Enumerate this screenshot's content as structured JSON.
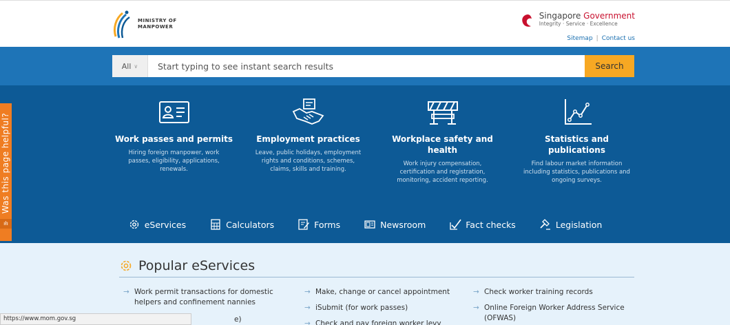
{
  "header": {
    "logo_line1": "MINISTRY OF",
    "logo_line2": "MANPOWER",
    "gov_name_a": "Singapore ",
    "gov_name_b": "Government",
    "gov_tagline": "Integrity · Service · Excellence",
    "links": [
      "Sitemap",
      "Contact us"
    ]
  },
  "search": {
    "scope": "All",
    "placeholder": "Start typing to see instant search results",
    "button": "Search"
  },
  "categories": [
    {
      "icon": "id-card-icon",
      "title": "Work passes and permits",
      "desc": "Hiring foreign manpower, work passes, eligibility, applications, renewals."
    },
    {
      "icon": "handshake-icon",
      "title": "Employment practices",
      "desc": "Leave, public holidays, employment rights and conditions, schemes, claims, skills and training."
    },
    {
      "icon": "barrier-icon",
      "title": "Workplace safety and health",
      "desc": "Work injury compensation, certification and registration, monitoring, accident reporting."
    },
    {
      "icon": "line-chart-icon",
      "title": "Statistics and publications",
      "desc": "Find labour market information including statistics, publications and ongoing surveys."
    }
  ],
  "quicklinks": [
    {
      "icon": "gear-icon",
      "label": "eServices"
    },
    {
      "icon": "calculator-icon",
      "label": "Calculators"
    },
    {
      "icon": "form-icon",
      "label": "Forms"
    },
    {
      "icon": "newspaper-icon",
      "label": "Newsroom"
    },
    {
      "icon": "checkmark-icon",
      "label": "Fact checks"
    },
    {
      "icon": "gavel-icon",
      "label": "Legislation"
    }
  ],
  "feedback": {
    "label": "Was this page helpful?",
    "foot": "ıłı"
  },
  "popular": {
    "title": "Popular eServices",
    "col1": [
      "Work permit transactions for domestic helpers and confinement nannies",
      "e)"
    ],
    "col2": [
      "Make, change or cancel appointment",
      "iSubmit (for work passes)",
      "Check and pay foreign worker levy"
    ],
    "col3": [
      "Check worker training records",
      "Online Foreign Worker Address Service (OFWAS)"
    ]
  },
  "status_url": "https://www.mom.gov.sg",
  "colors": {
    "blue": "#1e74b7",
    "navy": "#0d5a96",
    "orange": "#f7a823",
    "feedback": "#ef7d22",
    "light": "#e6f2fb"
  }
}
